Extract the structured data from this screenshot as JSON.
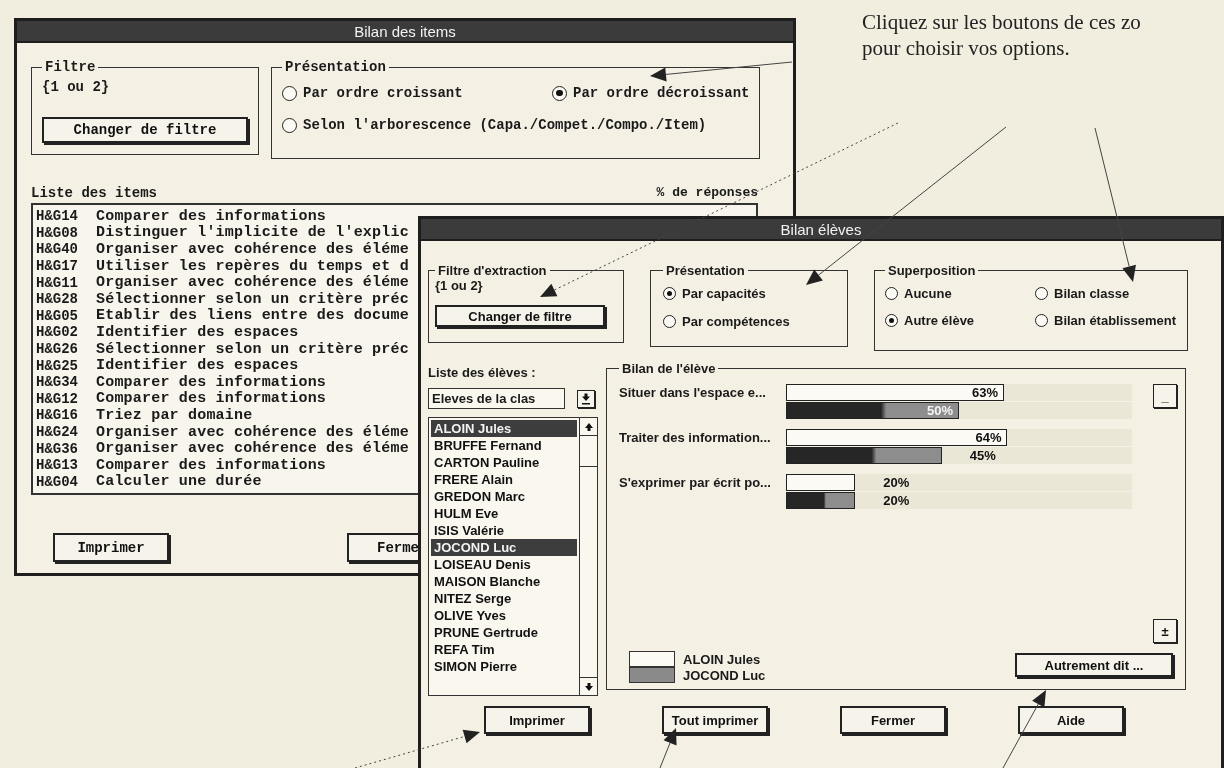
{
  "caption": [
    "Cliquez sur les boutons de ces zo",
    "pour choisir vos options."
  ],
  "items_window": {
    "title": "Bilan des items",
    "filter": {
      "legend": "Filtre",
      "value": "{1 ou 2}",
      "button": "Changer de filtre"
    },
    "presentation": {
      "legend": "Présentation",
      "options": [
        {
          "label": "Par ordre croissant",
          "selected": false
        },
        {
          "label": "Par ordre décroissant",
          "selected": true
        },
        {
          "label": "Selon l'arborescence (Capa./Compet./Compo./Item)",
          "selected": false
        }
      ]
    },
    "list_label": "Liste des items",
    "percent_header": "% de réponses",
    "items": [
      {
        "code": "H&G14",
        "label": "Comparer des informations"
      },
      {
        "code": "H&G08",
        "label": "Distinguer l'implicite de l'explic"
      },
      {
        "code": "H&G40",
        "label": "Organiser avec cohérence des éléme"
      },
      {
        "code": "H&G17",
        "label": "Utiliser les repères du temps et d"
      },
      {
        "code": "H&G11",
        "label": "Organiser avec cohérence des éléme"
      },
      {
        "code": "H&G28",
        "label": "Sélectionner selon un critère préc"
      },
      {
        "code": "H&G05",
        "label": "Etablir des liens entre des docume"
      },
      {
        "code": "H&G02",
        "label": "Identifier des espaces"
      },
      {
        "code": "H&G26",
        "label": "Sélectionner selon un critère préc"
      },
      {
        "code": "H&G25",
        "label": "Identifier des espaces"
      },
      {
        "code": "H&G34",
        "label": "Comparer des informations"
      },
      {
        "code": "H&G12",
        "label": "Comparer des informations"
      },
      {
        "code": "H&G16",
        "label": "Triez par domaine"
      },
      {
        "code": "H&G24",
        "label": "Organiser avec cohérence des éléme"
      },
      {
        "code": "H&G36",
        "label": "Organiser avec cohérence des éléme"
      },
      {
        "code": "H&G13",
        "label": "Comparer des informations"
      },
      {
        "code": "H&G04",
        "label": "Calculer une durée"
      }
    ],
    "buttons": [
      "Imprimer",
      "Ferme"
    ]
  },
  "students_window": {
    "title": "Bilan élèves",
    "filter": {
      "legend": "Filtre d'extraction",
      "value": "{1 ou 2}",
      "button": "Changer de filtre"
    },
    "presentation": {
      "legend": "Présentation",
      "options": [
        {
          "label": "Par capacités",
          "selected": true
        },
        {
          "label": "Par compétences",
          "selected": false
        }
      ]
    },
    "superposition": {
      "legend": "Superposition",
      "options": [
        {
          "label": "Aucune",
          "selected": false
        },
        {
          "label": "Bilan classe",
          "selected": false
        },
        {
          "label": "Autre élève",
          "selected": true
        },
        {
          "label": "Bilan établissement",
          "selected": false
        }
      ]
    },
    "list_label": "Liste des élèves :",
    "class_select": "Eleves de la clas",
    "students": [
      {
        "name": "ALOIN Jules",
        "selected": true
      },
      {
        "name": "BRUFFE Fernand",
        "selected": false
      },
      {
        "name": "CARTON Pauline",
        "selected": false
      },
      {
        "name": "FRERE Alain",
        "selected": false
      },
      {
        "name": "GREDON Marc",
        "selected": false
      },
      {
        "name": "HULM Eve",
        "selected": false
      },
      {
        "name": "ISIS Valérie",
        "selected": false
      },
      {
        "name": "JOCOND Luc",
        "selected": true
      },
      {
        "name": "LOISEAU Denis",
        "selected": false
      },
      {
        "name": "MAISON Blanche",
        "selected": false
      },
      {
        "name": "NITEZ Serge",
        "selected": false
      },
      {
        "name": "OLIVE Yves",
        "selected": false
      },
      {
        "name": "PRUNE Gertrude",
        "selected": false
      },
      {
        "name": "REFA Tim",
        "selected": false
      },
      {
        "name": "SIMON Pierre",
        "selected": false
      }
    ],
    "results": {
      "legend": "Bilan de l'élève",
      "rows": [
        {
          "label": "Situer dans l'espace e...",
          "bars": [
            {
              "level": 0.63,
              "reading": "63%"
            },
            {
              "level": 0.5,
              "reading": "50%"
            }
          ]
        },
        {
          "label": "Traiter des information...",
          "bars": [
            {
              "level": 0.64,
              "reading": "64%"
            },
            {
              "level": 0.45,
              "reading": "45%"
            }
          ]
        },
        {
          "label": "S'exprimer par écrit po...",
          "bars": [
            {
              "level": 0.2,
              "reading": "20%"
            },
            {
              "level": 0.2,
              "reading": "20%"
            }
          ]
        }
      ],
      "side_buttons": [
        "_",
        "±"
      ],
      "key": [
        "ALOIN Jules",
        "JOCOND Luc"
      ],
      "other_button": "Autrement dit ..."
    },
    "buttons": [
      "Imprimer",
      "Tout imprimer",
      "Fermer",
      "Aide"
    ]
  }
}
